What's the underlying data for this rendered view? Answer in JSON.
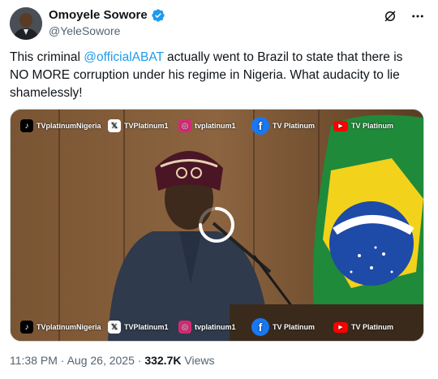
{
  "author": {
    "display_name": "Omoyele Sowore",
    "handle": "@YeleSowore"
  },
  "tweet": {
    "text_before": "This criminal ",
    "mention": "@officialABAT",
    "text_after": " actually went to Brazil to state that there is NO MORE corruption under his regime in Nigeria. What audacity to lie shamelessly!"
  },
  "watermarks": {
    "tiktok": "TVplatinumNigeria",
    "x": "TVPlatinum1",
    "instagram": "tvplatinum1",
    "facebook": "TV Platinum",
    "youtube": "TV Platinum"
  },
  "flag_text": "ORDEM E PROGRESSO",
  "meta": {
    "time": "11:38 PM",
    "date": "Aug 26, 2025",
    "separator": "·",
    "views_count": "332.7K",
    "views_label": "Views"
  },
  "colors": {
    "link": "#1d9bf0",
    "verified": "#1d9bf0",
    "secondary_text": "#536471"
  },
  "icons": [
    "verified-badge-icon",
    "grok-icon",
    "more-icon",
    "tiktok-icon",
    "x-logo-icon",
    "instagram-icon",
    "facebook-icon",
    "youtube-icon",
    "loading-spinner-icon"
  ]
}
